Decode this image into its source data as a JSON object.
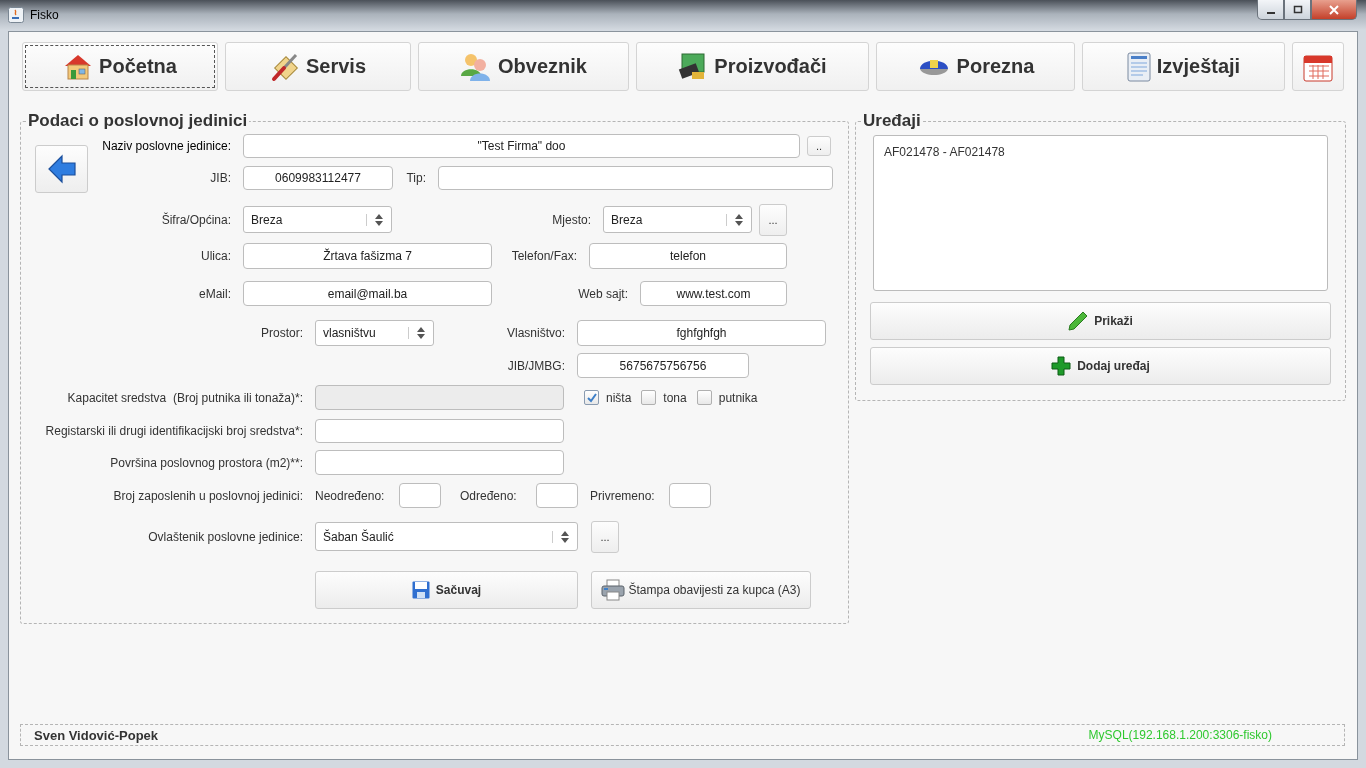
{
  "window": {
    "title": "Fisko"
  },
  "nav": [
    {
      "label": "Početna",
      "selected": true
    },
    {
      "label": "Servis",
      "selected": false
    },
    {
      "label": "Obveznik",
      "selected": false
    },
    {
      "label": "Proizvođači",
      "selected": false
    },
    {
      "label": "Porezna",
      "selected": false
    },
    {
      "label": "Izvještaji",
      "selected": false
    }
  ],
  "unit": {
    "title": "Podaci o poslovnoj jedinici",
    "name": {
      "label": "Naziv poslovne jedinice:",
      "value": "\"Test Firma\" doo",
      "button": ".."
    },
    "jib": {
      "label": "JIB:",
      "value": "0609983112477"
    },
    "tip": {
      "label": "Tip:"
    },
    "municipality": {
      "label": "Šifra/Općina:",
      "value": "Breza"
    },
    "place": {
      "label": "Mjesto:",
      "value": "Breza",
      "button": "..."
    },
    "street": {
      "label": "Ulica:",
      "value": "Žrtava fašizma 7"
    },
    "phone": {
      "label": "Telefon/Fax:",
      "value": "telefon"
    },
    "email": {
      "label": "eMail:",
      "value": "email@mail.ba"
    },
    "website": {
      "label": "Web sajt:",
      "value": "www.test.com"
    },
    "premises": {
      "label": "Prostor:",
      "value": "vlasništvu"
    },
    "ownership": {
      "label": "Vlasništvo:",
      "value": "fghfghfgh"
    },
    "jmbg": {
      "label": "JIB/JMBG:",
      "value": "5675675756756"
    },
    "capacity": {
      "label": "Kapacitet sredstva  (Broj putnika ili tonaža)*:",
      "disabled": true
    },
    "capacity_units": [
      {
        "label": "ništa",
        "checked": true
      },
      {
        "label": "tona",
        "checked": false
      },
      {
        "label": "putnika",
        "checked": false
      }
    ],
    "registration": {
      "label": "Registarski ili drugi identifikacijski broj sredstva*:"
    },
    "area": {
      "label": "Površina poslovnog prostora (m2)**:"
    },
    "employees": {
      "label": "Broj zaposlenih u poslovnoj jedinici:",
      "fields": [
        {
          "label": "Neodređeno:"
        },
        {
          "label": "Određeno:"
        },
        {
          "label": "Privremeno:"
        }
      ]
    },
    "representative": {
      "label": "Ovlaštenik poslovne jedinice:",
      "value": "Šaban Šaulić",
      "button": "..."
    },
    "save_button": "Sačuvaj",
    "print_button": "Štampa obavijesti za kupca (A3)"
  },
  "devices": {
    "title": "Uređaji",
    "items": [
      {
        "label": "AF021478 - AF021478"
      }
    ],
    "show_button": "Prikaži",
    "add_button": "Dodaj uređaj"
  },
  "status_bar": {
    "user": "Sven Vidović-Popek",
    "connection": "MySQL(192.168.1.200:3306-fisko)"
  }
}
